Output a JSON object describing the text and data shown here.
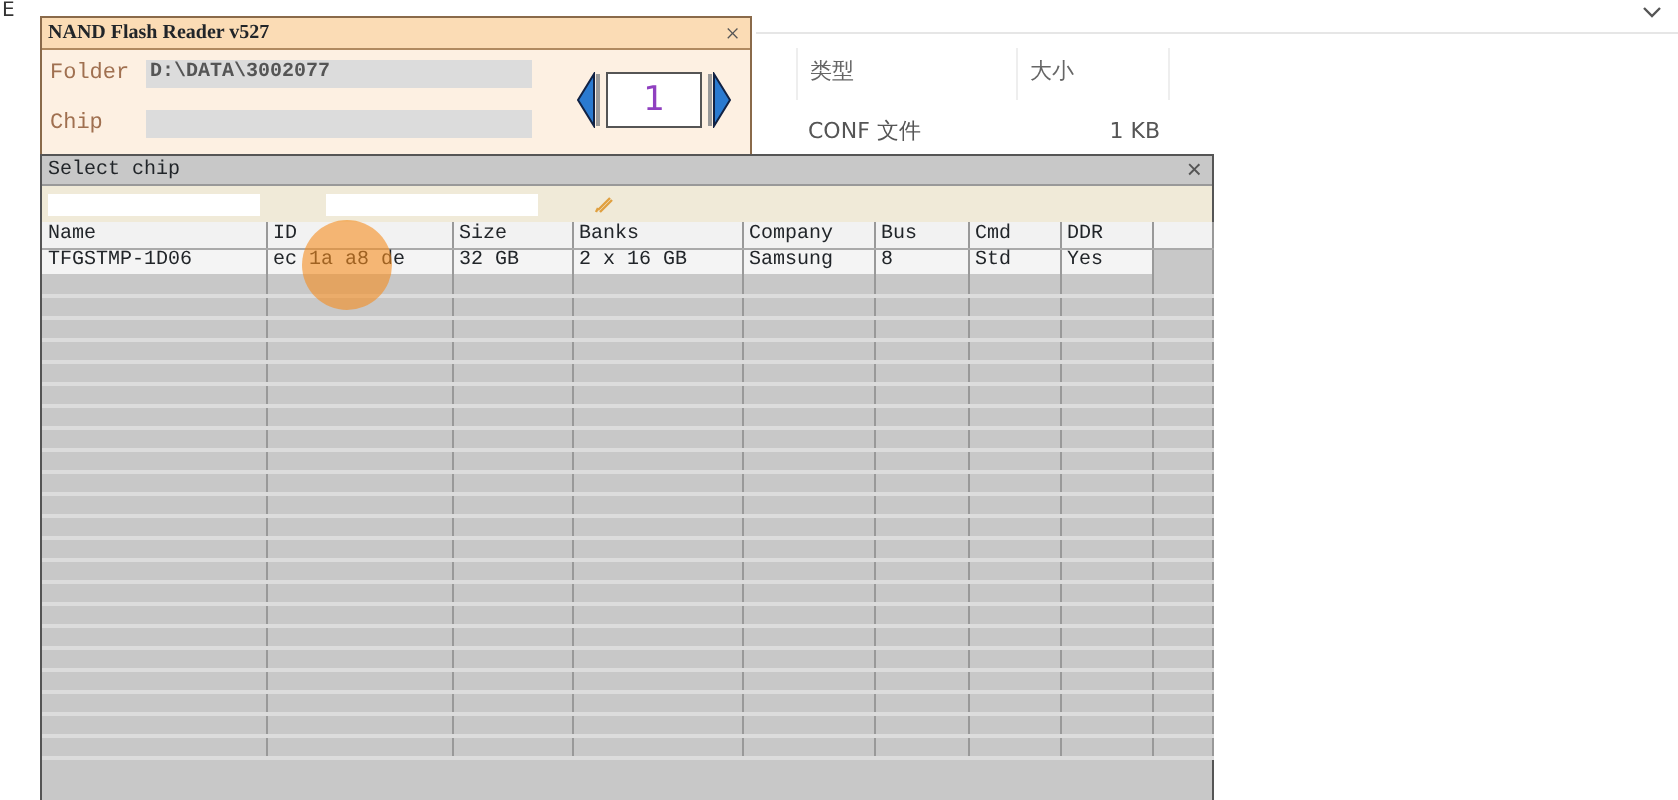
{
  "explorer": {
    "corner_letter": "E",
    "columns": [
      "类型",
      "大小"
    ],
    "rows": [
      {
        "type": "CONF 文件",
        "size": "1 KB"
      }
    ]
  },
  "reader_window": {
    "title": "NAND Flash Reader v527",
    "close": "×",
    "fields": [
      {
        "label": "Folder",
        "value": "D:\\DATA\\3002077"
      },
      {
        "label": "Chip"
      }
    ],
    "counter": "1"
  },
  "chip_window": {
    "title": "Select chip",
    "close": "×",
    "columns": [
      "Name",
      "ID",
      "Size",
      "Banks",
      "Company",
      "Bus",
      "Cmd",
      "DDR"
    ],
    "rows": [
      {
        "cells": [
          "TFGSTMP-1D06",
          "ec 1a a8 de",
          "32 GB",
          "2 x 16 GB",
          "Samsung",
          "8",
          "Std",
          "Yes"
        ],
        "selected": true
      }
    ]
  }
}
